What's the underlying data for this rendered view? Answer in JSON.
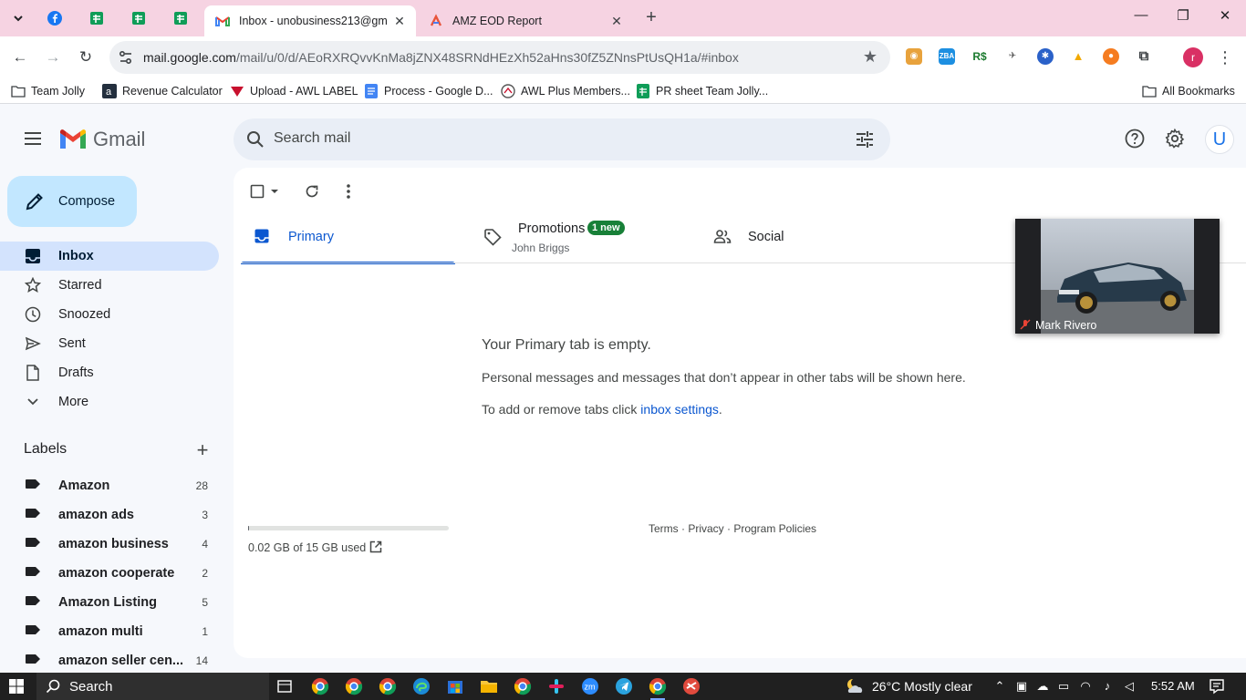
{
  "browser": {
    "tabs": [
      {
        "title": "Inbox - unobusiness213@gmail.",
        "active": true
      },
      {
        "title": "AMZ EOD Report",
        "active": false
      }
    ],
    "url_host": "mail.google.com",
    "url_path": "/mail/u/0/d/AEoRXRQvvKnMa8jZNX48SRNdHEzXh52aHns30fZ5ZNnsPtUsQH1a/#inbox",
    "profile_initial": "r",
    "bookmarks": [
      "Team Jolly",
      "Revenue Calculator",
      "Upload - AWL LABEL",
      "Process - Google D...",
      "AWL Plus Members...",
      "PR sheet Team Jolly..."
    ],
    "all_bookmarks": "All Bookmarks"
  },
  "gmail": {
    "logo_text": "Gmail",
    "search_placeholder": "Search mail",
    "avatar_initial": "U",
    "compose_label": "Compose",
    "nav": [
      {
        "label": "Inbox",
        "icon": "inbox-icon"
      },
      {
        "label": "Starred",
        "icon": "star-icon"
      },
      {
        "label": "Snoozed",
        "icon": "clock-icon"
      },
      {
        "label": "Sent",
        "icon": "send-icon"
      },
      {
        "label": "Drafts",
        "icon": "draft-icon"
      },
      {
        "label": "More",
        "icon": "chevron-down-icon"
      }
    ],
    "labels_header": "Labels",
    "labels": [
      {
        "name": "Amazon",
        "count": "28"
      },
      {
        "name": "amazon ads",
        "count": "3"
      },
      {
        "name": "amazon business",
        "count": "4"
      },
      {
        "name": "amazon cooperate",
        "count": "2"
      },
      {
        "name": "Amazon Listing",
        "count": "5"
      },
      {
        "name": "amazon multi",
        "count": "1"
      },
      {
        "name": "amazon seller cen...",
        "count": "14"
      }
    ],
    "category_tabs": {
      "primary": "Primary",
      "promotions": "Promotions",
      "promotions_badge": "1 new",
      "promotions_sender": "John Briggs",
      "social": "Social"
    },
    "empty": {
      "title": "Your Primary tab is empty.",
      "message": "Personal messages and messages that don’t appear in other tabs will be shown here.",
      "settings_prefix": "To add or remove tabs click ",
      "settings_link": "inbox settings",
      "settings_suffix": "."
    },
    "storage": {
      "text": "0.02 GB of 15 GB used",
      "fraction": 0.0013
    },
    "footer": "Terms · Privacy · Program Policies"
  },
  "video_call": {
    "participant": "Mark Rivero"
  },
  "taskbar": {
    "search_label": "Search",
    "weather": "26°C  Mostly clear",
    "time": "5:52 AM"
  }
}
